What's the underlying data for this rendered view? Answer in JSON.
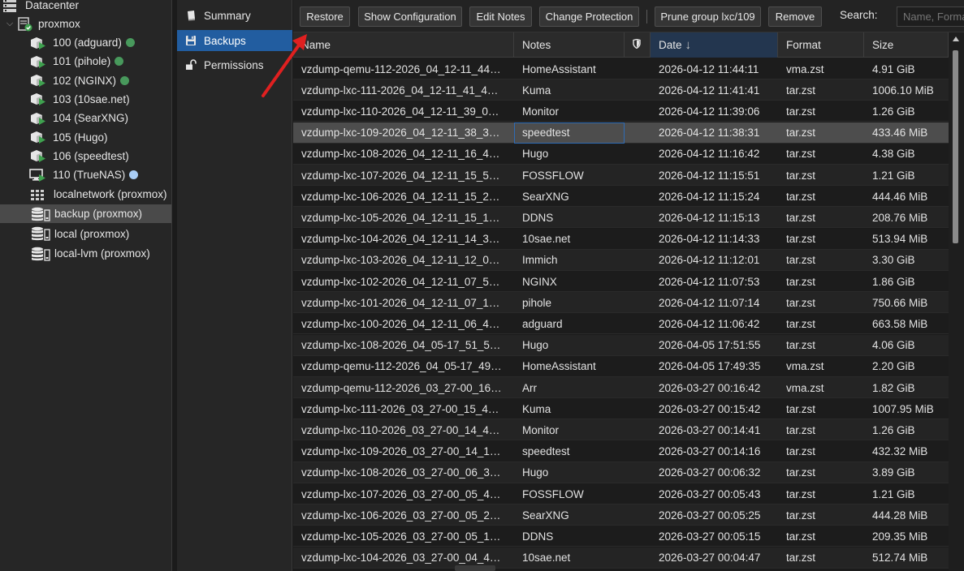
{
  "tree": {
    "datacenter": "Datacenter",
    "node": "proxmox",
    "guests": [
      {
        "label": "100 (adguard)",
        "type": "lxc",
        "dot": "green"
      },
      {
        "label": "101 (pihole)",
        "type": "lxc",
        "dot": "green"
      },
      {
        "label": "102 (NGINX)",
        "type": "lxc",
        "dot": "green"
      },
      {
        "label": "103 (10sae.net)",
        "type": "lxc",
        "dot": ""
      },
      {
        "label": "104 (SearXNG)",
        "type": "lxc",
        "dot": ""
      },
      {
        "label": "105 (Hugo)",
        "type": "lxc",
        "dot": ""
      },
      {
        "label": "106 (speedtest)",
        "type": "lxc",
        "dot": ""
      },
      {
        "label": "110 (TrueNAS)",
        "type": "qemu",
        "dot": "blue"
      }
    ],
    "network": "localnetwork (proxmox)",
    "storages": [
      "backup (proxmox)",
      "local (proxmox)",
      "local-lvm (proxmox)"
    ],
    "selected_storage_index": 0
  },
  "subnav": {
    "items": [
      {
        "label": "Summary",
        "icon": "book-icon"
      },
      {
        "label": "Backups",
        "icon": "floppy-icon"
      },
      {
        "label": "Permissions",
        "icon": "unlock-icon"
      }
    ],
    "active": "Backups"
  },
  "toolbar": {
    "restore": "Restore",
    "show_config": "Show Configuration",
    "edit_notes": "Edit Notes",
    "change_protection": "Change Protection",
    "prune_group": "Prune group lxc/109",
    "remove": "Remove",
    "search_label": "Search:",
    "search_placeholder": "Name, Format, Notes"
  },
  "table": {
    "columns": {
      "name": "Name",
      "notes": "Notes",
      "protected": "shield-icon",
      "date": "Date",
      "date_sort": "descending",
      "format": "Format",
      "size": "Size"
    },
    "selected_row_index": 3,
    "rows": [
      {
        "name": "vzdump-qemu-112-2026_04_12-11_44…",
        "notes": "HomeAssistant",
        "date": "2026-04-12 11:44:11",
        "format": "vma.zst",
        "size": "4.91 GiB"
      },
      {
        "name": "vzdump-lxc-111-2026_04_12-11_41_4…",
        "notes": "Kuma",
        "date": "2026-04-12 11:41:41",
        "format": "tar.zst",
        "size": "1006.10 MiB"
      },
      {
        "name": "vzdump-lxc-110-2026_04_12-11_39_0…",
        "notes": "Monitor",
        "date": "2026-04-12 11:39:06",
        "format": "tar.zst",
        "size": "1.26 GiB"
      },
      {
        "name": "vzdump-lxc-109-2026_04_12-11_38_3…",
        "notes": "speedtest",
        "date": "2026-04-12 11:38:31",
        "format": "tar.zst",
        "size": "433.46 MiB"
      },
      {
        "name": "vzdump-lxc-108-2026_04_12-11_16_4…",
        "notes": "Hugo",
        "date": "2026-04-12 11:16:42",
        "format": "tar.zst",
        "size": "4.38 GiB"
      },
      {
        "name": "vzdump-lxc-107-2026_04_12-11_15_5…",
        "notes": "FOSSFLOW",
        "date": "2026-04-12 11:15:51",
        "format": "tar.zst",
        "size": "1.21 GiB"
      },
      {
        "name": "vzdump-lxc-106-2026_04_12-11_15_2…",
        "notes": "SearXNG",
        "date": "2026-04-12 11:15:24",
        "format": "tar.zst",
        "size": "444.46 MiB"
      },
      {
        "name": "vzdump-lxc-105-2026_04_12-11_15_1…",
        "notes": "DDNS",
        "date": "2026-04-12 11:15:13",
        "format": "tar.zst",
        "size": "208.76 MiB"
      },
      {
        "name": "vzdump-lxc-104-2026_04_12-11_14_3…",
        "notes": "10sae.net",
        "date": "2026-04-12 11:14:33",
        "format": "tar.zst",
        "size": "513.94 MiB"
      },
      {
        "name": "vzdump-lxc-103-2026_04_12-11_12_0…",
        "notes": "Immich",
        "date": "2026-04-12 11:12:01",
        "format": "tar.zst",
        "size": "3.30 GiB"
      },
      {
        "name": "vzdump-lxc-102-2026_04_12-11_07_5…",
        "notes": "NGINX",
        "date": "2026-04-12 11:07:53",
        "format": "tar.zst",
        "size": "1.86 GiB"
      },
      {
        "name": "vzdump-lxc-101-2026_04_12-11_07_1…",
        "notes": "pihole",
        "date": "2026-04-12 11:07:14",
        "format": "tar.zst",
        "size": "750.66 MiB"
      },
      {
        "name": "vzdump-lxc-100-2026_04_12-11_06_4…",
        "notes": "adguard",
        "date": "2026-04-12 11:06:42",
        "format": "tar.zst",
        "size": "663.58 MiB"
      },
      {
        "name": "vzdump-lxc-108-2026_04_05-17_51_5…",
        "notes": "Hugo",
        "date": "2026-04-05 17:51:55",
        "format": "tar.zst",
        "size": "4.06 GiB"
      },
      {
        "name": "vzdump-qemu-112-2026_04_05-17_49…",
        "notes": "HomeAssistant",
        "date": "2026-04-05 17:49:35",
        "format": "vma.zst",
        "size": "2.20 GiB"
      },
      {
        "name": "vzdump-qemu-112-2026_03_27-00_16…",
        "notes": "Arr",
        "date": "2026-03-27 00:16:42",
        "format": "vma.zst",
        "size": "1.82 GiB"
      },
      {
        "name": "vzdump-lxc-111-2026_03_27-00_15_4…",
        "notes": "Kuma",
        "date": "2026-03-27 00:15:42",
        "format": "tar.zst",
        "size": "1007.95 MiB"
      },
      {
        "name": "vzdump-lxc-110-2026_03_27-00_14_4…",
        "notes": "Monitor",
        "date": "2026-03-27 00:14:41",
        "format": "tar.zst",
        "size": "1.26 GiB"
      },
      {
        "name": "vzdump-lxc-109-2026_03_27-00_14_1…",
        "notes": "speedtest",
        "date": "2026-03-27 00:14:16",
        "format": "tar.zst",
        "size": "432.32 MiB"
      },
      {
        "name": "vzdump-lxc-108-2026_03_27-00_06_3…",
        "notes": "Hugo",
        "date": "2026-03-27 00:06:32",
        "format": "tar.zst",
        "size": "3.89 GiB"
      },
      {
        "name": "vzdump-lxc-107-2026_03_27-00_05_4…",
        "notes": "FOSSFLOW",
        "date": "2026-03-27 00:05:43",
        "format": "tar.zst",
        "size": "1.21 GiB"
      },
      {
        "name": "vzdump-lxc-106-2026_03_27-00_05_2…",
        "notes": "SearXNG",
        "date": "2026-03-27 00:05:25",
        "format": "tar.zst",
        "size": "444.28 MiB"
      },
      {
        "name": "vzdump-lxc-105-2026_03_27-00_05_1…",
        "notes": "DDNS",
        "date": "2026-03-27 00:05:15",
        "format": "tar.zst",
        "size": "209.35 MiB"
      },
      {
        "name": "vzdump-lxc-104-2026_03_27-00_04_4…",
        "notes": "10sae.net",
        "date": "2026-03-27 00:04:47",
        "format": "tar.zst",
        "size": "512.74 MiB"
      }
    ]
  },
  "colors": {
    "accent": "#225da0",
    "annotation_arrow": "#e02020",
    "status_green": "#4fae66",
    "status_blue": "#a9cdf5"
  }
}
